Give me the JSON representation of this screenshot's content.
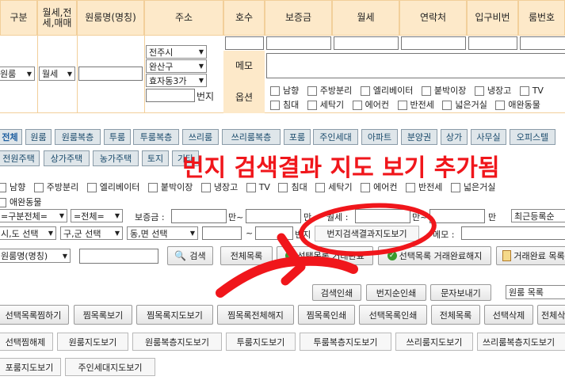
{
  "header": {
    "cols": [
      "구분",
      "월세,전\n세,매매",
      "원룸명(명칭)",
      "주소",
      "호수",
      "보증금",
      "월세",
      "연락처",
      "입구비번",
      "룸번호"
    ]
  },
  "form": {
    "type_select": "원룸",
    "deal_select": "월세",
    "city_select": "전주시",
    "gu_select": "완산구",
    "dong_select": "효자동3가",
    "bunji_label": "번지",
    "memo_label": "메모",
    "option_label": "옵션",
    "options_row1": [
      "남향",
      "주방분리",
      "엘리베이터",
      "붙박이장",
      "냉장고",
      "TV"
    ],
    "options_row2": [
      "침대",
      "세탁기",
      "에어컨",
      "반전세",
      "넓은거실",
      "애완동물"
    ]
  },
  "tabs_row1": [
    "전체",
    "원룸",
    "원룸복층",
    "투룸",
    "투룸복층",
    "쓰리룸",
    "쓰리룸복층",
    "포룸",
    "주인세대",
    "아파트",
    "분양권",
    "상가",
    "사무실",
    "오피스텔"
  ],
  "tabs_row2": [
    "전원주택",
    "상가주택",
    "농가주택",
    "토지",
    "기타"
  ],
  "overlay_text": "번지 검색결과 지도 보기 추가됨",
  "filter_options": [
    "남향",
    "주방분리",
    "엘리베이터",
    "붙박이장",
    "냉장고",
    "TV",
    "침대",
    "세탁기",
    "에어컨",
    "반전세",
    "넓은거실"
  ],
  "filter_option_pet": "애완동물",
  "search": {
    "gubun_select": "=구분전체=",
    "all_select": "=전체=",
    "deposit_label": "보증금 :",
    "man1": "만~",
    "man2": "만",
    "rent_label": "월세 :",
    "man3": "만~",
    "man4": "만",
    "recent_select": "최근등록순",
    "sido_select": "시,도 선택",
    "gugun_select": "구,군 선택",
    "dongmyeon_select": "동,면 선택",
    "tilde": "~",
    "bunji_suffix": "번지",
    "bunji_map_button": "번지검색결과지도보기",
    "memo_label": "메모 :",
    "name_select": "원룸명(명칭)",
    "search_button": "검색",
    "all_list_button": "전체목록",
    "sel_complete_button": "선택목록 거래완료",
    "sel_cancel_button": "선택목록 거래완료해지",
    "complete_list_button": "거래완료 목록"
  },
  "actions_row1": [
    "검색인쇄",
    "번지순인쇄",
    "문자보내기"
  ],
  "list_select": "원룸 목록",
  "actions_row2": [
    "선택목록찜하기",
    "찜목록보기",
    "찜목록지도보기",
    "찜목록전체해지",
    "찜목록인쇄",
    "선택목록인쇄",
    "전체목록",
    "선택삭제",
    "전체삭"
  ],
  "actions_row3": [
    "선택찜해제",
    "원룸지도보기",
    "원룸복층지도보기",
    "투룸지도보기",
    "투룸복층지도보기",
    "쓰리룸지도보기",
    "쓰리룸복층지도보기"
  ],
  "actions_row4": [
    "포룸지도보기",
    "주인세대지도보기"
  ],
  "colors": {
    "accent_red": "#f0161b",
    "header_bg": "#fde9c9"
  }
}
